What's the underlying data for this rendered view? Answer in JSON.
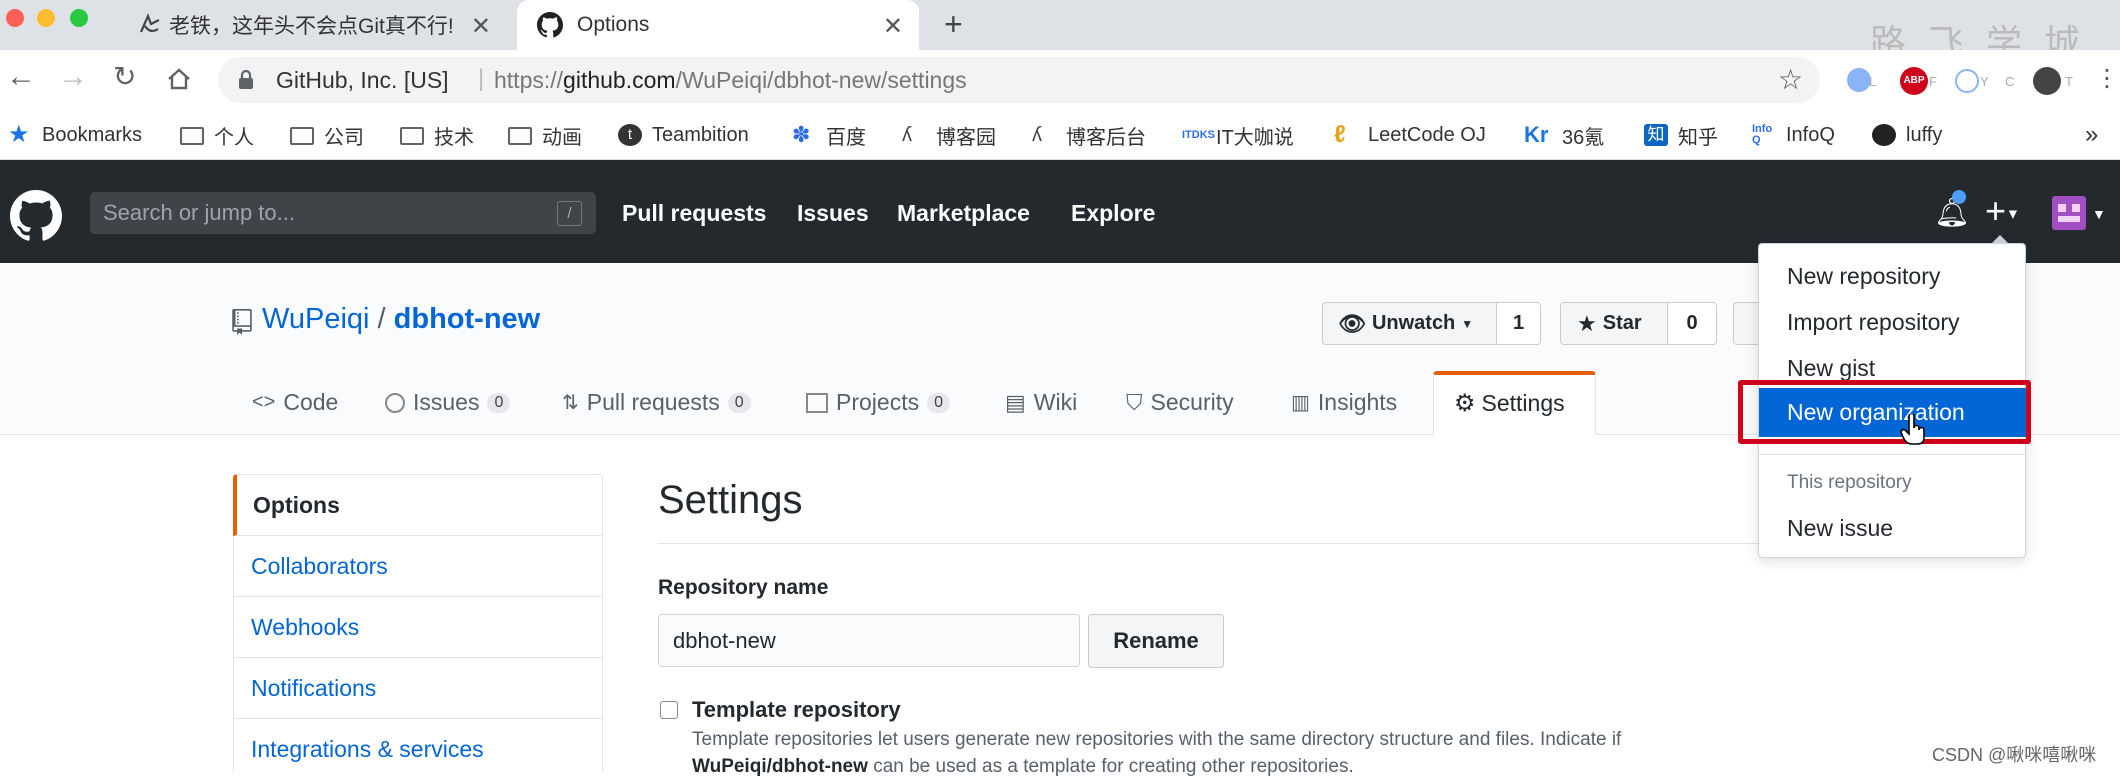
{
  "browser": {
    "tabs": [
      {
        "title": "老铁，这年头不会点Git真不行!",
        "active": false
      },
      {
        "title": "Options",
        "active": true
      }
    ],
    "url": {
      "org": "GitHub, Inc. [US]",
      "prefix": "https://",
      "host": "github.com",
      "path": "/WuPeiqi/dbhot-new/settings"
    },
    "bookmarks": [
      {
        "label": "Bookmarks",
        "icon": "star-icon"
      },
      {
        "label": "个人",
        "icon": "folder-icon"
      },
      {
        "label": "公司",
        "icon": "folder-icon"
      },
      {
        "label": "技术",
        "icon": "folder-icon"
      },
      {
        "label": "动画",
        "icon": "folder-icon"
      },
      {
        "label": "Teambition",
        "icon": "teambition-icon"
      },
      {
        "label": "百度",
        "icon": "baidu-paw-icon"
      },
      {
        "label": "博客园",
        "icon": "cnblogs-icon"
      },
      {
        "label": "博客后台",
        "icon": "cnblogs-icon"
      },
      {
        "label": "IT大咖说",
        "icon": "itdks-icon"
      },
      {
        "label": "LeetCode OJ",
        "icon": "leetcode-icon"
      },
      {
        "label": "36氪",
        "icon": "36kr-icon"
      },
      {
        "label": "知乎",
        "icon": "zhihu-icon"
      },
      {
        "label": "InfoQ",
        "icon": "infoq-icon"
      },
      {
        "label": "luffy",
        "icon": "github-icon"
      }
    ],
    "more": "»",
    "ext_letters": [
      "L",
      "F",
      "Y",
      "C",
      "T"
    ]
  },
  "watermark": "路 飞 学 城",
  "github": {
    "search_placeholder": "Search or jump to...",
    "slash": "/",
    "nav": [
      "Pull requests",
      "Issues",
      "Marketplace",
      "Explore"
    ],
    "plus": "+"
  },
  "repo": {
    "owner": "WuPeiqi",
    "sep": "/",
    "name": "dbhot-new",
    "watch_label": "Unwatch",
    "watch_count": "1",
    "star_label": "Star",
    "star_count": "0",
    "tabs": [
      {
        "label": "Code",
        "count": null,
        "icon": "code-icon"
      },
      {
        "label": "Issues",
        "count": "0",
        "icon": "issue-icon"
      },
      {
        "label": "Pull requests",
        "count": "0",
        "icon": "pull-request-icon"
      },
      {
        "label": "Projects",
        "count": "0",
        "icon": "project-icon"
      },
      {
        "label": "Wiki",
        "count": null,
        "icon": "book-icon"
      },
      {
        "label": "Security",
        "count": null,
        "icon": "shield-icon"
      },
      {
        "label": "Insights",
        "count": null,
        "icon": "graph-icon"
      },
      {
        "label": "Settings",
        "count": null,
        "icon": "gear-icon"
      }
    ]
  },
  "settings": {
    "menu": [
      "Options",
      "Collaborators",
      "Webhooks",
      "Notifications",
      "Integrations & services"
    ],
    "title": "Settings",
    "repo_name_label": "Repository name",
    "repo_name_value": "dbhot-new",
    "rename_label": "Rename",
    "template_label": "Template repository",
    "template_desc_1": "Template repositories let users generate new repositories with the same directory structure and files. Indicate if",
    "template_desc_2_bold": "WuPeiqi/dbhot-new",
    "template_desc_2": " can be used as a template for creating other repositories."
  },
  "dropdown": {
    "items": [
      "New repository",
      "Import repository",
      "New gist",
      "New organization"
    ],
    "section": "This repository",
    "issue": "New issue"
  },
  "credit": "CSDN @啾咪嘻啾咪",
  "colors": {
    "accent": "#0366d6",
    "header": "#24292e",
    "highlight_box": "#d0021b",
    "tab_accent": "#e36209"
  }
}
